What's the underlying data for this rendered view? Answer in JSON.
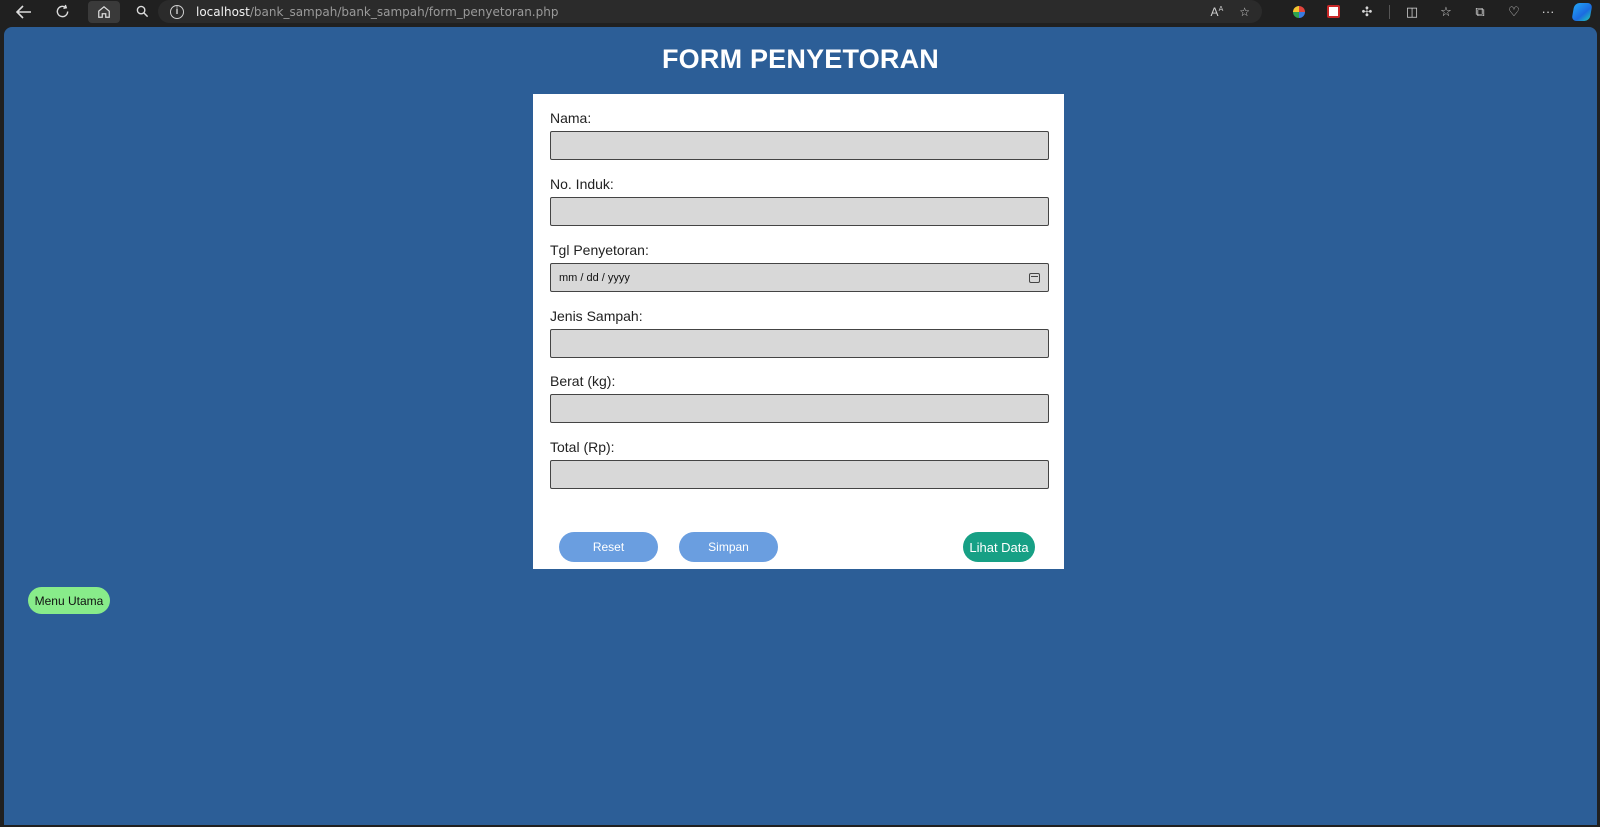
{
  "browser": {
    "url_host": "localhost",
    "url_path": "/bank_sampah/bank_sampah/form_penyetoran.php"
  },
  "page": {
    "title": "FORM PENYETORAN"
  },
  "form": {
    "fields": [
      {
        "label": "Nama:",
        "value": ""
      },
      {
        "label": "No. Induk:",
        "value": ""
      },
      {
        "label": "Tgl Penyetoran:",
        "placeholder": "mm / dd / yyyy"
      },
      {
        "label": "Jenis Sampah:",
        "value": ""
      },
      {
        "label": "Berat (kg):",
        "value": ""
      },
      {
        "label": "Total (Rp):",
        "value": ""
      }
    ],
    "buttons": {
      "reset": "Reset",
      "simpan": "Simpan",
      "lihat_data": "Lihat Data"
    }
  },
  "menu_utama": "Menu Utama",
  "colors": {
    "background": "#2c5e97",
    "primary_button": "#6a9ee0",
    "lihat_button": "#17a085",
    "menu_button": "#88ec8a"
  }
}
